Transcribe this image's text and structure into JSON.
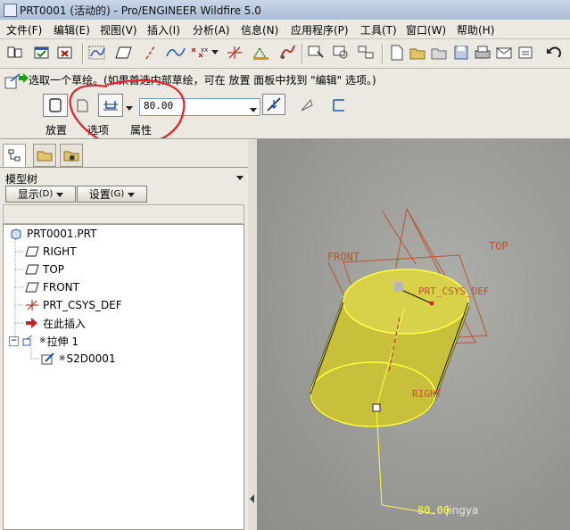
{
  "title_bar": {
    "title": "PRT0001 (活动的) - Pro/ENGINEER Wildfire 5.0"
  },
  "menu": [
    {
      "label": "文件(F)"
    },
    {
      "label": "编辑(E)"
    },
    {
      "label": "视图(V)"
    },
    {
      "label": "插入(I)"
    },
    {
      "label": "分析(A)"
    },
    {
      "label": "信息(N)"
    },
    {
      "label": "应用程序(P)"
    },
    {
      "label": "工具(T)"
    },
    {
      "label": "窗口(W)"
    },
    {
      "label": "帮助(H)"
    }
  ],
  "dashboard": {
    "prompt": "选取一个草绘。(如果首选内部草绘，可在 放置 面板中找到 \"编辑\" 选项。)",
    "depth_value": "80.00",
    "tabs": [
      {
        "label": "放置"
      },
      {
        "label": "选项"
      },
      {
        "label": "属性"
      }
    ]
  },
  "model_tree": {
    "title": "模型树",
    "show_button": "显示",
    "show_key": "(D)",
    "settings_button": "设置",
    "settings_key": "(G)",
    "items": [
      {
        "label": "PRT0001.PRT",
        "icon": "part-icon"
      },
      {
        "label": "RIGHT",
        "icon": "datum-plane-icon"
      },
      {
        "label": "TOP",
        "icon": "datum-plane-icon"
      },
      {
        "label": "FRONT",
        "icon": "datum-plane-icon"
      },
      {
        "label": "PRT_CSYS_DEF",
        "icon": "csys-icon"
      },
      {
        "label": "在此插入",
        "icon": "insert-arrow-icon"
      },
      {
        "label": "拉伸 1",
        "icon": "extrude-icon",
        "marker": "※"
      },
      {
        "label": "S2D0001",
        "icon": "sketch-icon",
        "marker": "※"
      }
    ]
  },
  "viewport": {
    "labels": {
      "front": "FRONT",
      "top": "TOP",
      "csys": "PRT_CSYS_DEF",
      "right": "RIGHT",
      "depth": "80.00",
      "watermark": "jingya"
    },
    "colors": {
      "solid": "#c8c03a",
      "outline": "#ffff3c",
      "datum": "#b8552e"
    }
  }
}
